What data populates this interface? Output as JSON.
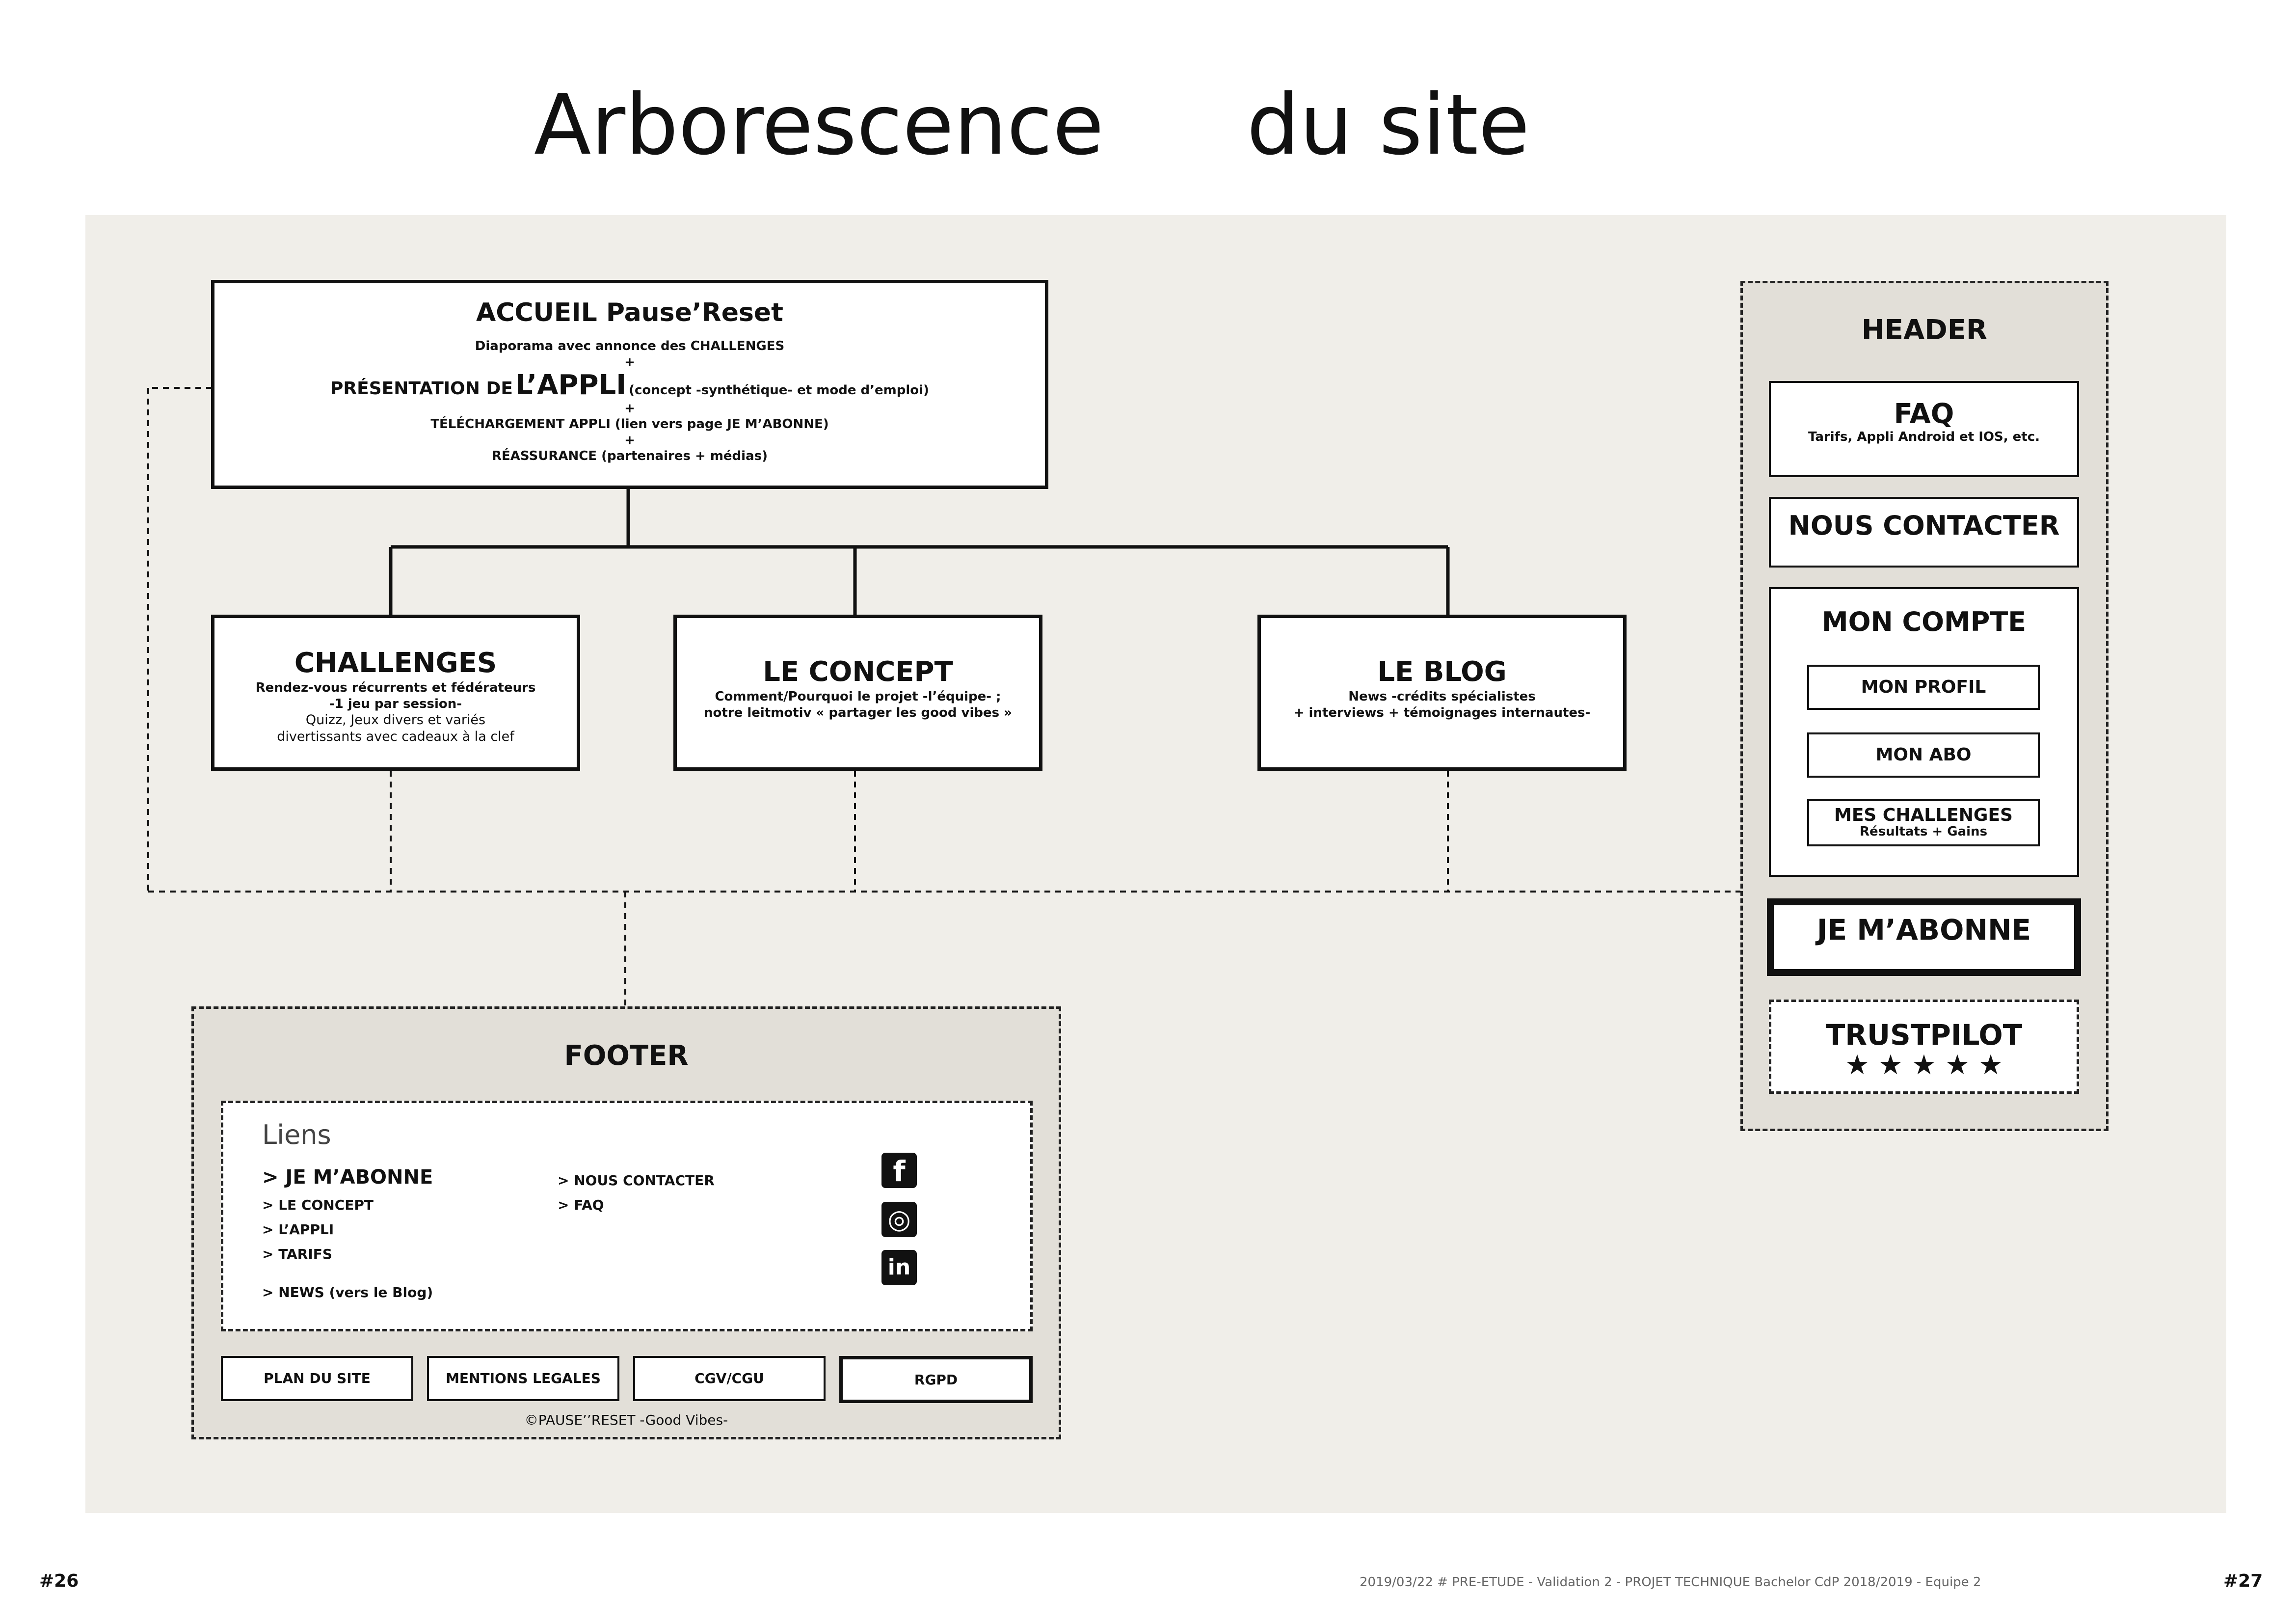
{
  "title": {
    "part1": "Arborescence",
    "part2": "du site"
  },
  "home": {
    "title": "ACCUEIL Pause’Reset",
    "line1": "Diaporama avec annonce des CHALLENGES",
    "plus": "+",
    "pres_prefix": "PRÉSENTATION DE",
    "pres_big": "L’APPLI",
    "pres_suffix": "(concept -synthétique- et mode d’emploi)",
    "line3": "TÉLÉCHARGEMENT APPLI (lien vers page JE M’ABONNE)",
    "line4": "RÉASSURANCE (partenaires + médias)"
  },
  "pages": [
    {
      "title": "CHALLENGES",
      "l1": "Rendez-vous récurrents et fédérateurs",
      "l2": "-1 jeu par session-",
      "l3": "Quizz, Jeux divers et variés",
      "l4": "divertissants avec cadeaux à la clef"
    },
    {
      "title": "LE CONCEPT",
      "l1": "Comment/Pourquoi le projet -l’équipe- ;",
      "l2": "notre leitmotiv « partager les good vibes »"
    },
    {
      "title": "LE BLOG",
      "l1": "News -crédits spécialistes",
      "l2": "+ interviews + témoignages  internautes-"
    }
  ],
  "header": {
    "title": "HEADER",
    "faq": {
      "title": "FAQ",
      "desc": "Tarifs, Appli Android et IOS, etc."
    },
    "contact": "NOUS CONTACTER",
    "account": {
      "title": "MON COMPTE",
      "profile": "MON PROFIL",
      "abo": "MON ABO",
      "challenges": "MES CHALLENGES",
      "challenges_desc": "Résultats + Gains"
    },
    "subscribe": "JE M’ABONNE",
    "trustpilot": "TRUSTPILOT",
    "stars": "★ ★ ★ ★ ★"
  },
  "footer": {
    "title": "FOOTER",
    "links_title": "Liens",
    "links_col1": [
      "> JE M’ABONNE",
      "> LE CONCEPT",
      "> L’APPLI",
      "> TARIFS",
      "> NEWS (vers le Blog)"
    ],
    "links_col2": [
      "> NOUS CONTACTER",
      "> FAQ"
    ],
    "social": [
      "facebook-icon",
      "instagram-icon",
      "linkedin-icon"
    ],
    "social_glyphs": [
      "f",
      "◎",
      "in"
    ],
    "buttons": [
      "PLAN DU SITE",
      "MENTIONS LEGALES",
      "CGV/CGU",
      "RGPD"
    ],
    "copyright": "©PAUSE’’RESET -Good Vibes-"
  },
  "page_footer": {
    "left_num": "#26",
    "right_num": "#27",
    "text": "2019/03/22  #  PRE-ETUDE - Validation 2  -  PROJET TECHNIQUE Bachelor CdP 2018/2019  -  Equipe 2"
  }
}
